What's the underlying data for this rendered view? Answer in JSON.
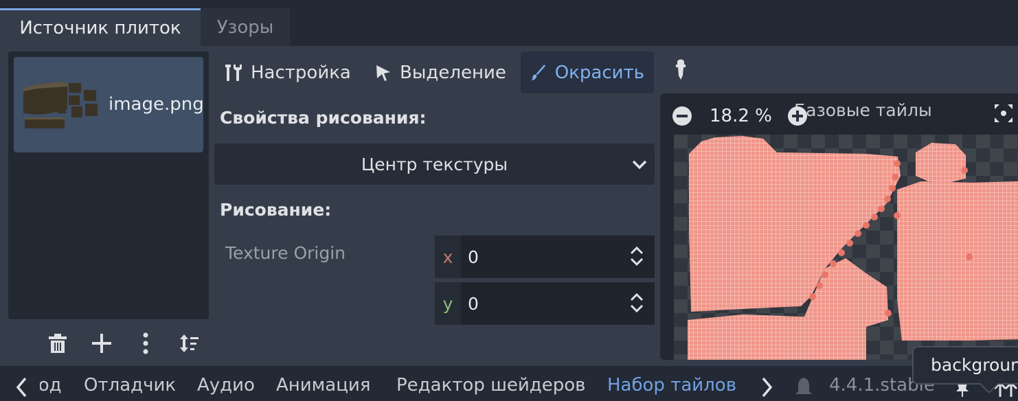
{
  "tabs": {
    "tile_sources": "Источник плиток",
    "patterns": "Узоры"
  },
  "source_list": {
    "items": [
      {
        "label": "image.png"
      }
    ]
  },
  "modes": {
    "setup": "Настройка",
    "select": "Выделение",
    "paint": "Окрасить"
  },
  "paint_props": {
    "title": "Свойства рисования:",
    "property_value": "Центр текстуры",
    "painting_title": "Рисование:",
    "field_label": "Texture Origin",
    "x_label": "x",
    "x_value": "0",
    "y_label": "y",
    "y_value": "0"
  },
  "atlas": {
    "zoom": "18.2 %",
    "title": "Базовые тайлы"
  },
  "bottom": {
    "output": "Вывод",
    "debugger": "Отладчик",
    "audio": "Аудио",
    "animation": "Анимация",
    "shader_editor": "Редактор шейдеров",
    "tileset": "Набор тайлов",
    "version": "4.4.1.stable"
  },
  "tooltip": "background"
}
